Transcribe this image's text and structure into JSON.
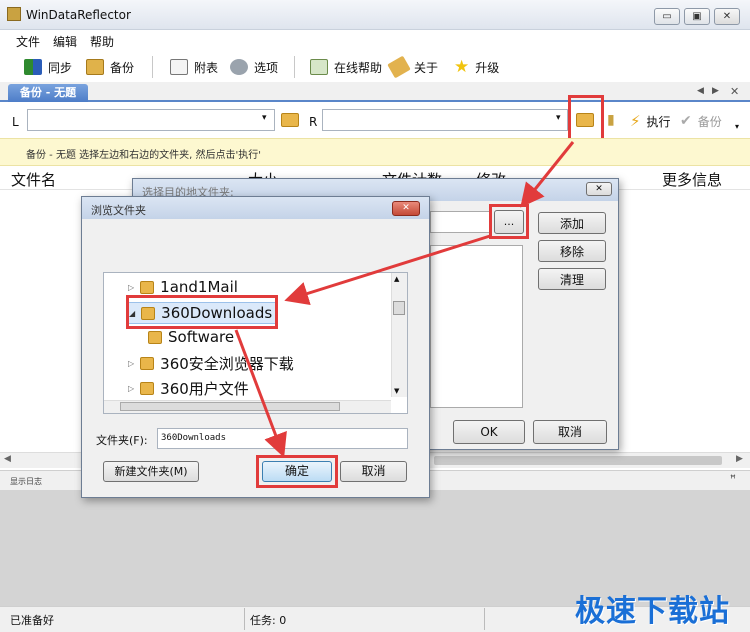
{
  "window": {
    "title": "WinDataReflector",
    "min": "▭",
    "max": "▣",
    "close": "✕"
  },
  "menu": [
    "文件",
    "编辑",
    "帮助"
  ],
  "toolbar": {
    "sync": "同步",
    "backup": "备份",
    "report": "附表",
    "options": "选项",
    "online_help": "在线帮助",
    "about": "关于",
    "upgrade": "升级"
  },
  "tab": {
    "label": "备份 - 无题"
  },
  "path": {
    "left_label": "L",
    "right_label": "R",
    "execute": "执行",
    "backup": "备份"
  },
  "hint": "备份 - 无题    选择左边和右边的文件夹, 然后点击'执行'",
  "columns": [
    "文件名",
    "大小",
    "文件计数",
    "修改",
    "更多信息"
  ],
  "log_label": "显示日志",
  "status": {
    "ready": "已准备好",
    "tasks": "任务: 0"
  },
  "target_dialog": {
    "title": "选择目的地文件夹:",
    "browse": "...",
    "add": "添加",
    "remove": "移除",
    "clear": "清理",
    "ok": "OK",
    "cancel": "取消"
  },
  "browse_dialog": {
    "title": "浏览文件夹",
    "tree": [
      "1and1Mail",
      "360Downloads",
      "Software",
      "360安全浏览器下载",
      "360用户文件"
    ],
    "folder_label": "文件夹(F):",
    "folder_value": "360Downloads",
    "new_folder": "新建文件夹(M)",
    "ok": "确定",
    "cancel": "取消"
  },
  "watermark": "极速下载站",
  "colors": {
    "accent": "#5a86c9",
    "highlight": "#e13b3b",
    "hint_bg": "#fdf8d0"
  }
}
